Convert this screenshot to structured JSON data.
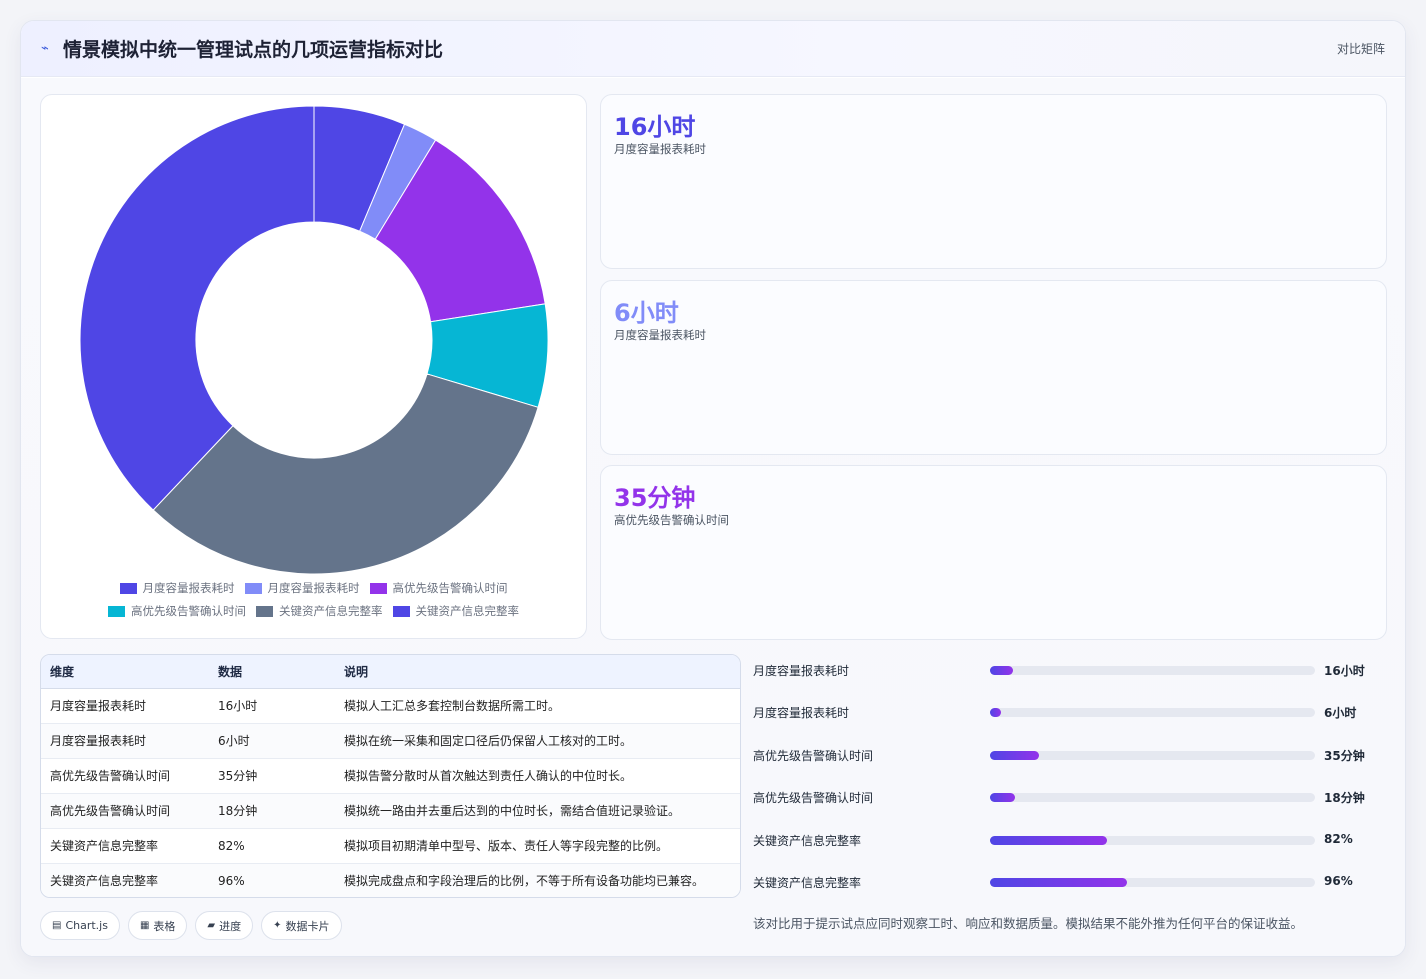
{
  "header": {
    "title": "情景模拟中统一管理试点的几项运营指标对比",
    "link": "对比矩阵",
    "icon": "trend-icon"
  },
  "chart_data": {
    "type": "pie",
    "variant": "doughnut",
    "categories": [
      "月度容量报表耗时",
      "月度容量报表耗时",
      "高优先级告警确认时间",
      "高优先级告警确认时间",
      "关键资产信息完整率",
      "关键资产信息完整率"
    ],
    "values": [
      16,
      6,
      35,
      18,
      82,
      96
    ],
    "colors": [
      "#4f46e5",
      "#818cf8",
      "#9333ea",
      "#06b6d4",
      "#64748b",
      "#4f46e5"
    ],
    "legend_position": "bottom",
    "title": ""
  },
  "kpis": [
    {
      "value": "16小时",
      "label": "月度容量报表耗时",
      "color": "#4f46e5"
    },
    {
      "value": "6小时",
      "label": "月度容量报表耗时",
      "color": "#818cf8"
    },
    {
      "value": "35分钟",
      "label": "高优先级告警确认时间",
      "color": "#9333ea"
    }
  ],
  "table": {
    "headers": [
      "维度",
      "数据",
      "说明"
    ],
    "rows": [
      [
        "月度容量报表耗时",
        "16小时",
        "模拟人工汇总多套控制台数据所需工时。"
      ],
      [
        "月度容量报表耗时",
        "6小时",
        "模拟在统一采集和固定口径后仍保留人工核对的工时。"
      ],
      [
        "高优先级告警确认时间",
        "35分钟",
        "模拟告警分散时从首次触达到责任人确认的中位时长。"
      ],
      [
        "高优先级告警确认时间",
        "18分钟",
        "模拟统一路由并去重后达到的中位时长，需结合值班记录验证。"
      ],
      [
        "关键资产信息完整率",
        "82%",
        "模拟项目初期清单中型号、版本、责任人等字段完整的比例。"
      ],
      [
        "关键资产信息完整率",
        "96%",
        "模拟完成盘点和字段治理后的比例，不等于所有设备功能均已兼容。"
      ]
    ]
  },
  "chips": [
    {
      "icon": "chart-icon",
      "glyph": "▤",
      "label": "Chart.js"
    },
    {
      "icon": "table-icon",
      "glyph": "▦",
      "label": "表格"
    },
    {
      "icon": "progress-icon",
      "glyph": "▰",
      "label": "进度"
    },
    {
      "icon": "card-icon",
      "glyph": "✦",
      "label": "数据卡片"
    }
  ],
  "progress": [
    {
      "label": "月度容量报表耗时",
      "value": "16小时",
      "fraction": 0.07
    },
    {
      "label": "月度容量报表耗时",
      "value": "6小时",
      "fraction": 0.035
    },
    {
      "label": "高优先级告警确认时间",
      "value": "35分钟",
      "fraction": 0.15
    },
    {
      "label": "高优先级告警确认时间",
      "value": "18分钟",
      "fraction": 0.078
    },
    {
      "label": "关键资产信息完整率",
      "value": "82%",
      "fraction": 0.36
    },
    {
      "label": "关键资产信息完整率",
      "value": "96%",
      "fraction": 0.42
    }
  ],
  "note": "该对比用于提示试点应同时观察工时、响应和数据质量。模拟结果不能外推为任何平台的保证收益。"
}
